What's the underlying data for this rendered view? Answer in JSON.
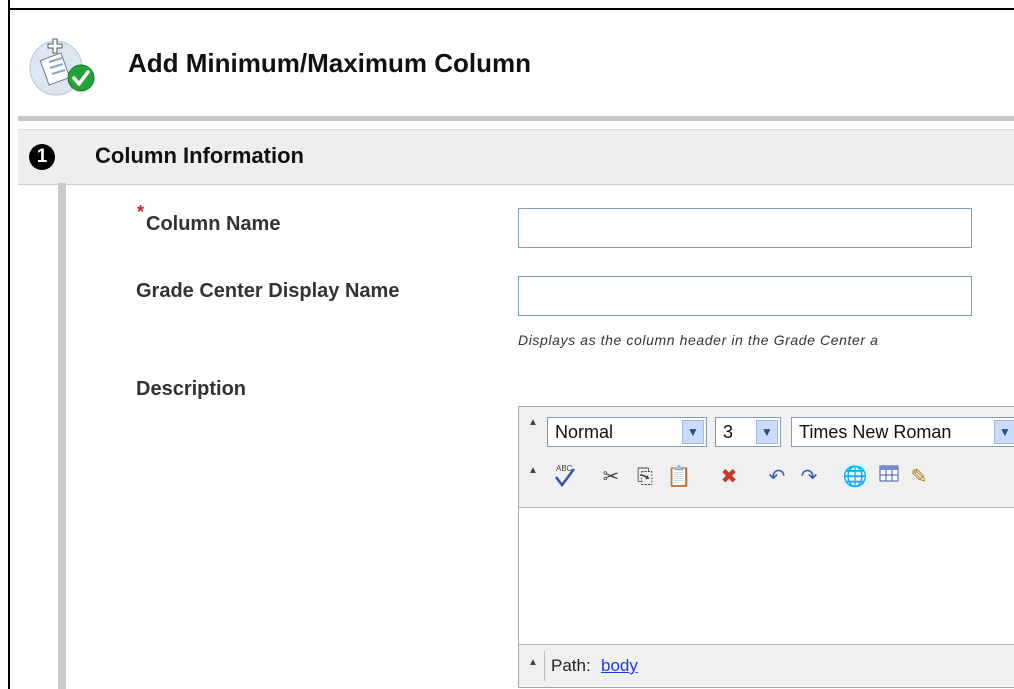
{
  "header": {
    "title": "Add Minimum/Maximum Column",
    "icon": "add-column-icon"
  },
  "step": {
    "number": "1",
    "title": "Column Information"
  },
  "form": {
    "required_marker": "*",
    "column_name_label": "Column Name",
    "column_name_value": "",
    "display_name_label": "Grade Center Display Name",
    "display_name_value": "",
    "display_name_hint": "Displays as the column header in the Grade Center a",
    "description_label": "Description"
  },
  "editor": {
    "format_value": "Normal",
    "size_value": "3",
    "font_value": "Times New Roman",
    "path_label": "Path:",
    "path_value": "body",
    "tools": [
      "spellcheck-icon",
      "cut-icon",
      "copy-icon",
      "paste-icon",
      "remove-format-icon",
      "undo-icon",
      "redo-icon",
      "insert-link-icon",
      "insert-table-icon",
      "pencil-icon"
    ]
  },
  "colors": {
    "required": "#cc2222",
    "input_border": "#7f9db9",
    "link": "#1a3bd6",
    "step_bg": "#eeeeee"
  }
}
